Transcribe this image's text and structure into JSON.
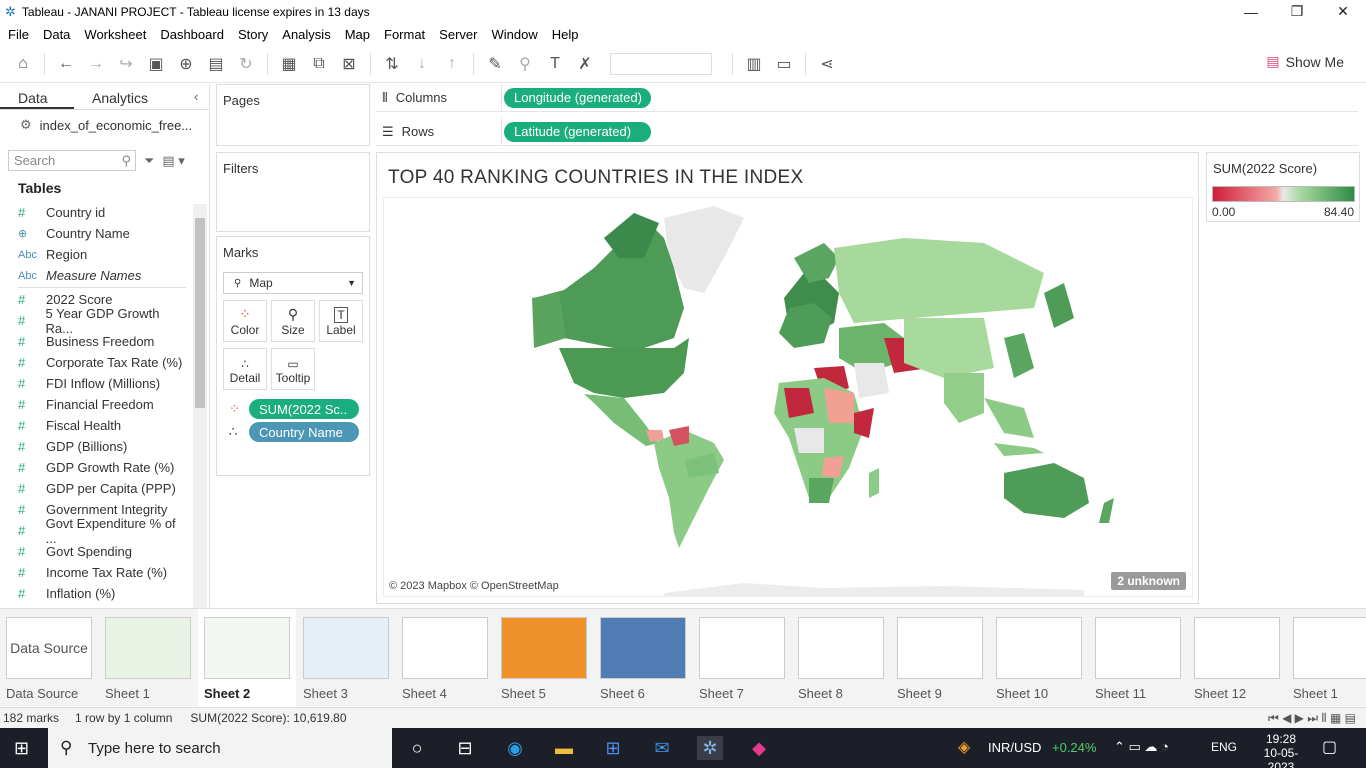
{
  "window": {
    "title": "Tableau - JANANI PROJECT - Tableau license expires in 13 days"
  },
  "menu": [
    "File",
    "Data",
    "Worksheet",
    "Dashboard",
    "Story",
    "Analysis",
    "Map",
    "Format",
    "Server",
    "Window",
    "Help"
  ],
  "toolbar": {
    "show_me": "Show Me"
  },
  "left_panel": {
    "tabs": [
      "Data",
      "Analytics"
    ],
    "datasource": "index_of_economic_free...",
    "search_placeholder": "Search",
    "tables_heading": "Tables",
    "fields": [
      {
        "type": "#",
        "name": "Country id"
      },
      {
        "type": "globe",
        "name": "Country Name"
      },
      {
        "type": "Abc",
        "name": "Region"
      },
      {
        "type": "Abc",
        "name": "Measure Names",
        "italic": true
      },
      {
        "type": "#",
        "name": "2022 Score"
      },
      {
        "type": "#",
        "name": "5 Year GDP Growth Ra..."
      },
      {
        "type": "#",
        "name": "Business Freedom"
      },
      {
        "type": "#",
        "name": "Corporate Tax Rate (%)"
      },
      {
        "type": "#",
        "name": "FDI Inflow (Millions)"
      },
      {
        "type": "#",
        "name": "Financial Freedom"
      },
      {
        "type": "#",
        "name": "Fiscal Health"
      },
      {
        "type": "#",
        "name": "GDP (Billions)"
      },
      {
        "type": "#",
        "name": "GDP Growth Rate (%)"
      },
      {
        "type": "#",
        "name": "GDP per Capita (PPP)"
      },
      {
        "type": "#",
        "name": "Government Integrity"
      },
      {
        "type": "#",
        "name": "Govt Expenditure % of ..."
      },
      {
        "type": "#",
        "name": "Govt Spending"
      },
      {
        "type": "#",
        "name": "Income Tax Rate (%)"
      },
      {
        "type": "#",
        "name": "Inflation (%)"
      }
    ]
  },
  "cards": {
    "pages": "Pages",
    "filters": "Filters",
    "marks": "Marks",
    "mark_type": "Map",
    "mark_buttons": [
      "Color",
      "Size",
      "Label",
      "Detail",
      "Tooltip"
    ],
    "mark_pills": [
      "SUM(2022 Sc..",
      "Country Name"
    ]
  },
  "shelves": {
    "columns_label": "Columns",
    "columns_pill": "Longitude (generated)",
    "rows_label": "Rows",
    "rows_pill": "Latitude (generated)"
  },
  "worksheet": {
    "title": "TOP 40 RANKING COUNTRIES IN THE INDEX",
    "attribution": "© 2023 Mapbox © OpenStreetMap",
    "unknown": "2 unknown"
  },
  "legend": {
    "title": "SUM(2022 Score)",
    "min": "0.00",
    "max": "84.40",
    "colors": {
      "low": "#d01c3a",
      "mid": "#e9e9e9",
      "high": "#2e8b45"
    }
  },
  "sheet_tabs": [
    "Data Source",
    "Sheet 1",
    "Sheet 2",
    "Sheet 3",
    "Sheet 4",
    "Sheet 5",
    "Sheet 6",
    "Sheet 7",
    "Sheet 8",
    "Sheet 9",
    "Sheet 10",
    "Sheet 11",
    "Sheet 12",
    "Sheet 1"
  ],
  "active_tab": "Sheet 2",
  "status": {
    "marks": "182 marks",
    "rows": "1 row by 1 column",
    "sum": "SUM(2022 Score): 10,619.80"
  },
  "taskbar": {
    "search_placeholder": "Type here to search",
    "currency": "INR/USD",
    "change": "+0.24%",
    "lang": "ENG",
    "time": "19:28",
    "date": "10-05-2023"
  }
}
